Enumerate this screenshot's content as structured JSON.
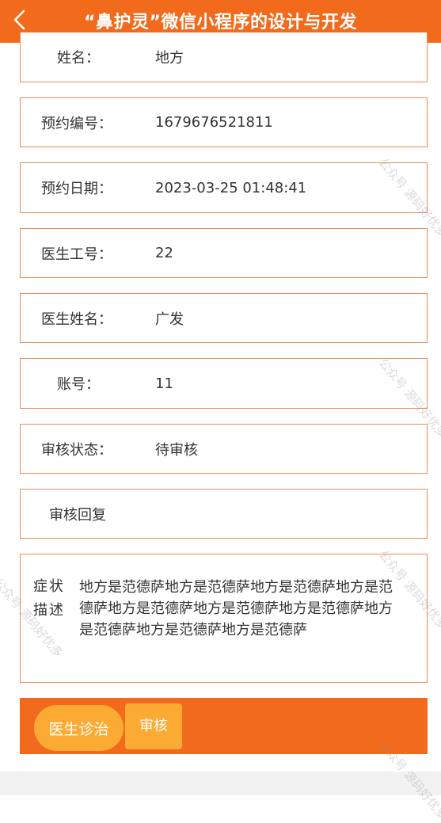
{
  "header": {
    "title": "“鼻护灵”微信小程序的设计与开发",
    "back_icon": "chevron-left-icon"
  },
  "fields": [
    {
      "label": "姓名：",
      "value": "地方"
    },
    {
      "label": "预约编号：",
      "value": "1679676521811"
    },
    {
      "label": "预约日期：",
      "value": "2023-03-25 01:48:41"
    },
    {
      "label": "医生工号：",
      "value": "22"
    },
    {
      "label": "医生姓名：",
      "value": "广发"
    },
    {
      "label": "账号：",
      "value": "11"
    },
    {
      "label": "审核状态：",
      "value": "待审核"
    },
    {
      "label": "审核回复",
      "value": ""
    }
  ],
  "symptom": {
    "label": "症状描述",
    "value": "地方是范德萨地方是范德萨地方是范德萨地方是范德萨地方是范德萨地方是范德萨地方是范德萨地方是范德萨地方是范德萨地方是范德萨"
  },
  "actions": {
    "diagnose_label": "医生诊治",
    "review_label": "审核"
  },
  "watermark": "公众号 源码好优多",
  "colors": {
    "accent": "#f26a1b",
    "button": "#fbab33",
    "field_border": "#e98a5a"
  }
}
